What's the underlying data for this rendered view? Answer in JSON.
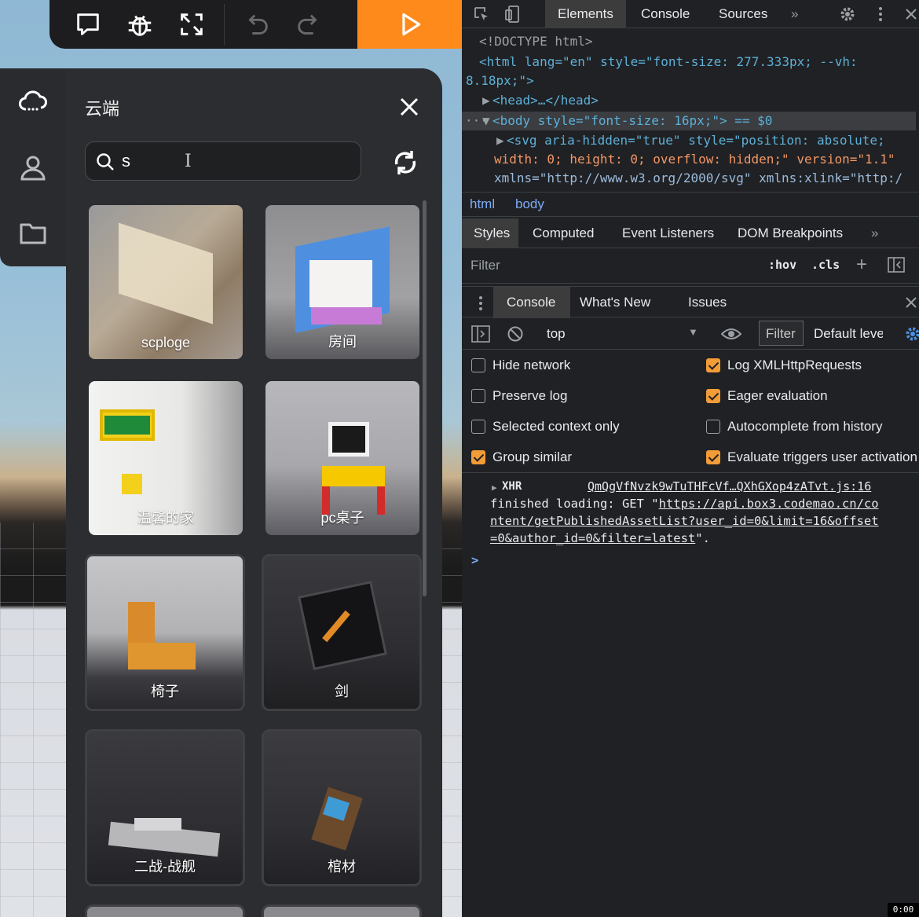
{
  "editor": {
    "panel_title": "云端",
    "search": {
      "value": "s",
      "placeholder": ""
    },
    "assets": [
      {
        "name": "scploge"
      },
      {
        "name": "房间"
      },
      {
        "name": "温馨的家"
      },
      {
        "name": "pc桌子"
      },
      {
        "name": "椅子"
      },
      {
        "name": "剑"
      },
      {
        "name": "二战-战舰"
      },
      {
        "name": "棺材"
      }
    ],
    "colors": {
      "run_button": "#ff8a1c",
      "panel": "#2c2d30",
      "toolbar": "#1d1d1f"
    }
  },
  "devtools": {
    "tabs": [
      "Elements",
      "Console",
      "Sources"
    ],
    "dom_lines": {
      "doctype": "<!DOCTYPE html>",
      "html_open_1": "<html lang=\"en\" style=\"font-size: 277.333px; --vh:",
      "html_open_2": "8.18px;\">",
      "head": "<head>…</head>",
      "body_open": "<body style=\"font-size: 16px;\"> == $0",
      "svg_1": "<svg aria-hidden=\"true\" style=\"position: absolute;",
      "svg_2": "width: 0; height: 0; overflow: hidden;\" version=\"1.1\"",
      "svg_3": "xmlns=\"http://www.w3.org/2000/svg\" xmlns:xlink=\"http:/"
    },
    "breadcrumbs": [
      "html",
      "body"
    ],
    "styles_tabs": [
      "Styles",
      "Computed",
      "Event Listeners",
      "DOM Breakpoints"
    ],
    "filter_placeholder": "Filter",
    "hov": ":hov",
    "cls": ".cls",
    "drawer_tabs": [
      "Console",
      "What's New",
      "Issues"
    ],
    "context": "top",
    "console_filter": "Filter",
    "levels": "Default levels",
    "settings": [
      {
        "label": "Hide network",
        "checked": false
      },
      {
        "label": "Log XMLHttpRequests",
        "checked": true
      },
      {
        "label": "Preserve log",
        "checked": false
      },
      {
        "label": "Eager evaluation",
        "checked": true
      },
      {
        "label": "Selected context only",
        "checked": false
      },
      {
        "label": "Autocomplete from history",
        "checked": false
      },
      {
        "label": "Group similar",
        "checked": true
      },
      {
        "label": "Evaluate triggers user activation",
        "checked": true
      }
    ],
    "log": {
      "type": "XHR",
      "source": "QmQgVfNvzk9wTuTHFcVf…QXhGXop4zATvt.js:16",
      "line1": "finished loading: GET \"",
      "url_1": "https://api.box3.codemao.cn/co",
      "url_2": "ntent/getPublishedAssetList?user_id=0&limit=16&offset",
      "url_3": "=0&author_id=0&filter=latest",
      "end": "\"."
    },
    "prompt": ">",
    "time_badge": "0:00"
  }
}
